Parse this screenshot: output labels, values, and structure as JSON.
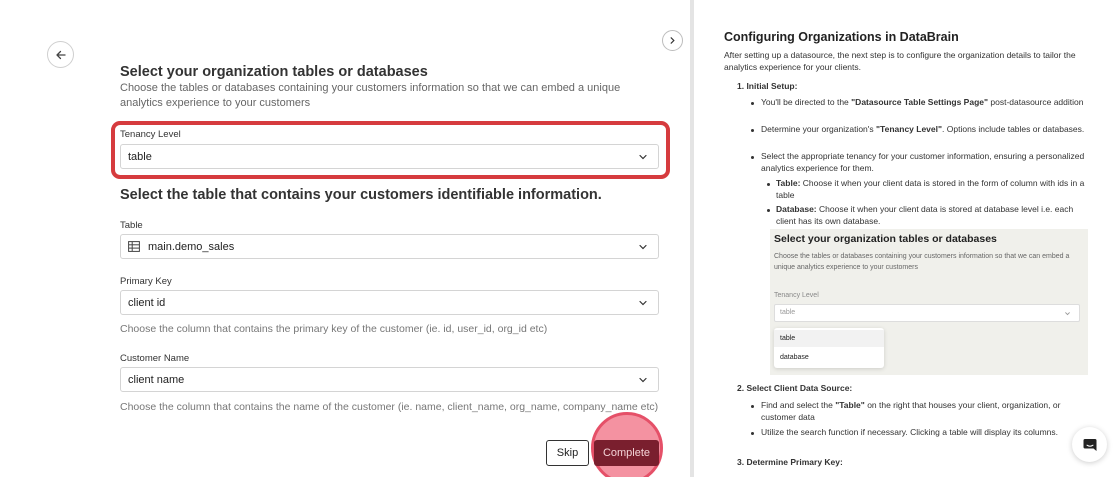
{
  "left": {
    "title": "Select your organization tables or databases",
    "description": "Choose the tables or databases containing your customers information so that we can embed a unique analytics experience to your customers",
    "tenancy": {
      "label": "Tenancy Level",
      "value": "table"
    },
    "subtitle": "Select the table that contains your customers identifiable information.",
    "table": {
      "label": "Table",
      "value": "main.demo_sales"
    },
    "primary_key": {
      "label": "Primary Key",
      "value": "client id",
      "help": "Choose the column that contains the primary key of the customer (ie. id, user_id, org_id etc)"
    },
    "customer_name": {
      "label": "Customer Name",
      "value": "client name",
      "help": "Choose the column that contains the name of the customer (ie. name, client_name, org_name, company_name etc)"
    },
    "skip_label": "Skip",
    "complete_label": "Complete"
  },
  "right": {
    "title": "Configuring Organizations in DataBrain",
    "intro": "After setting up a datasource, the next step is to configure the organization details to tailor the analytics experience for your clients.",
    "step1": "1. Initial Setup:",
    "b1_pre": "You'll be directed to the ",
    "b1_bold": "\"Datasource Table Settings Page\"",
    "b1_post": " post-datasource addition",
    "b2_pre": "Determine your organization's ",
    "b2_bold": "\"Tenancy Level\"",
    "b2_post": ". Options include tables or databases.",
    "b3": "Select the appropriate tenancy for your customer information, ensuring a personalized analytics experience for them.",
    "s1_bold": "Table:",
    "s1_text": " Choose it when your client data is stored in the form of column with ids in a table",
    "s2_bold": "Database:",
    "s2_text": " Choose it when your client data is stored at database level i.e. each client has its own database.",
    "embed": {
      "title": "Select your organization tables or databases",
      "desc": "Choose the tables or databases containing your customers information so that we can embed a unique analytics experience to your customers",
      "label": "Tenancy Level",
      "value": "table",
      "opt1": "table",
      "opt2": "database"
    },
    "step2": "2. Select Client Data Source:",
    "c1_pre": "Find and select the ",
    "c1_bold": "\"Table\"",
    "c1_post": " on the right that houses your client, organization, or customer data",
    "c2": "Utilize the search function if necessary. Clicking a table will display its columns.",
    "step3": "3. Determine Primary Key:"
  }
}
